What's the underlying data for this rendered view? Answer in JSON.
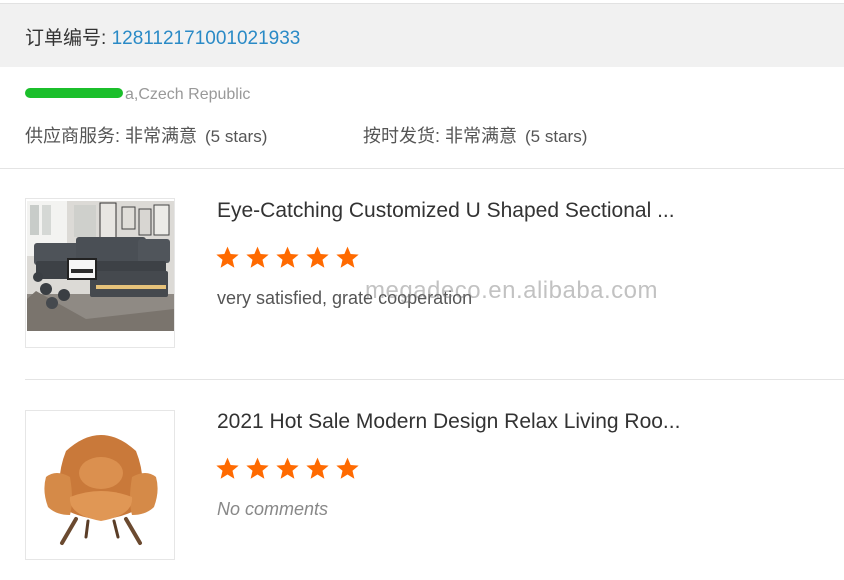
{
  "order": {
    "label": "订单编号: ",
    "number": "128112171001021933"
  },
  "buyer": {
    "location": "a,Czech Republic"
  },
  "seller_ratings": [
    {
      "label": "供应商服务: 非常满意",
      "note": "(5 stars)",
      "stars": 5
    },
    {
      "label": "按时发货: 非常满意",
      "note": "(5 stars)",
      "stars": 5
    }
  ],
  "reviews": [
    {
      "title": "Eye-Catching Customized U Shaped Sectional ...",
      "rating": 5,
      "comment": "very satisfied, grate cooperation",
      "image": "sectional-sofa"
    },
    {
      "title": "2021 Hot Sale Modern Design Relax Living Roo...",
      "rating": 5,
      "comment": "No comments",
      "image": "lounge-chair"
    }
  ],
  "watermark": "megadeco.en.alibaba.com",
  "colors": {
    "star": "#ff6a00",
    "order_number": "#2a8ac6",
    "header_bg": "#f1f1f1",
    "redaction": "#1bbf2b"
  }
}
